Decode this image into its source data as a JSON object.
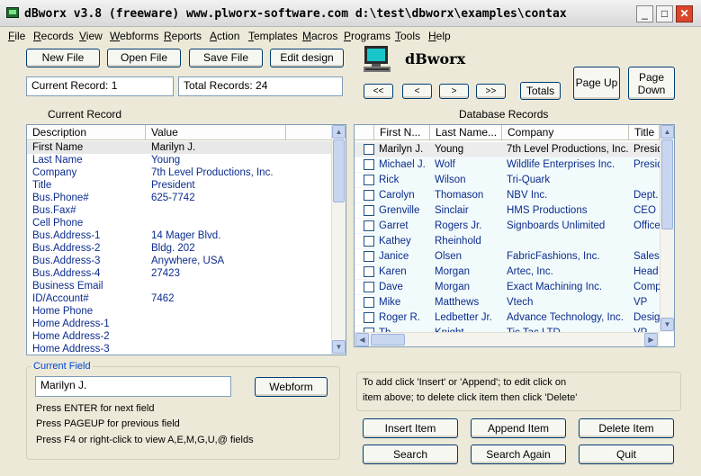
{
  "window": {
    "title": "dBworx  v3.8 (freeware)  www.plworx-software.com   d:\\test\\dbworx\\examples\\contax",
    "minimize": "_",
    "maximize": "□",
    "close": "✕"
  },
  "menu": [
    "File",
    "Records",
    "View",
    "Webforms",
    "Reports",
    "Action",
    "Templates",
    "Macros",
    "Programs",
    "Tools",
    "Help"
  ],
  "toolbar": {
    "new_file": "New File",
    "open_file": "Open File",
    "save_file": "Save File",
    "edit_design": "Edit design"
  },
  "brand": "dBworx",
  "status": {
    "current_record": "Current Record: 1",
    "total_records": "Total Records: 24"
  },
  "nav": {
    "first": "<<",
    "prev": "<",
    "next": ">",
    "last": ">>",
    "totals": "Totals",
    "page_up": "Page Up",
    "page_down": "Page Down"
  },
  "left_panel": {
    "heading": "Current Record",
    "columns": [
      "Description",
      "Value"
    ],
    "rows": [
      {
        "d": "First Name",
        "v": "Marilyn J."
      },
      {
        "d": "Last Name",
        "v": "Young"
      },
      {
        "d": "Company",
        "v": "7th Level Productions, Inc."
      },
      {
        "d": "Title",
        "v": "President"
      },
      {
        "d": "Bus.Phone#",
        "v": "625-7742"
      },
      {
        "d": "Bus.Fax#",
        "v": ""
      },
      {
        "d": "Cell Phone",
        "v": ""
      },
      {
        "d": "Bus.Address-1",
        "v": "14 Mager Blvd."
      },
      {
        "d": "Bus.Address-2",
        "v": "Bldg. 202"
      },
      {
        "d": "Bus.Address-3",
        "v": "Anywhere, USA"
      },
      {
        "d": "Bus.Address-4",
        "v": "27423"
      },
      {
        "d": "Business Email",
        "v": ""
      },
      {
        "d": "ID/Account#",
        "v": "7462"
      },
      {
        "d": "Home Phone",
        "v": ""
      },
      {
        "d": "Home Address-1",
        "v": ""
      },
      {
        "d": "Home Address-2",
        "v": ""
      },
      {
        "d": "Home Address-3",
        "v": ""
      }
    ]
  },
  "right_panel": {
    "heading": "Database Records",
    "columns": [
      "First N...",
      "Last Name...",
      "Company",
      "Title"
    ],
    "rows": [
      {
        "f": "Marilyn J.",
        "l": "Young",
        "c": "7th Level Productions, Inc.",
        "t": "Presid"
      },
      {
        "f": "Michael J.",
        "l": "Wolf",
        "c": "Wildlife Enterprises Inc.",
        "t": "Presid"
      },
      {
        "f": "Rick",
        "l": "Wilson",
        "c": "Tri-Quark",
        "t": ""
      },
      {
        "f": "Carolyn",
        "l": "Thomason",
        "c": "NBV Inc.",
        "t": "Dept."
      },
      {
        "f": "Grenville",
        "l": "Sinclair",
        "c": "HMS Productions",
        "t": "CEO"
      },
      {
        "f": "Garret",
        "l": "Rogers Jr.",
        "c": "Signboards Unlimited",
        "t": "Office"
      },
      {
        "f": "Kathey",
        "l": "Rheinhold",
        "c": "",
        "t": ""
      },
      {
        "f": "Janice",
        "l": "Olsen",
        "c": "FabricFashions, Inc.",
        "t": "Sales"
      },
      {
        "f": "Karen",
        "l": "Morgan",
        "c": "Artec, Inc.",
        "t": "Head"
      },
      {
        "f": "Dave",
        "l": "Morgan",
        "c": "Exact Machining Inc.",
        "t": "Compt"
      },
      {
        "f": "Mike",
        "l": "Matthews",
        "c": "Vtech",
        "t": "VP"
      },
      {
        "f": "Roger R.",
        "l": "Ledbetter Jr.",
        "c": "Advance Technology, Inc.",
        "t": "Design"
      },
      {
        "f": "Th...",
        "l": "Knight",
        "c": "Tic Tac LTD",
        "t": "VP"
      }
    ]
  },
  "current_field": {
    "label": "Current Field",
    "value": "Marilyn J.",
    "webform": "Webform",
    "help": [
      "Press ENTER for next field",
      "Press PAGEUP for previous field",
      "Press F4 or right-click to view A,E,M,G,U,@ fields"
    ]
  },
  "info": [
    "To add click 'Insert' or 'Append'; to edit click on",
    "item above; to delete click item then click 'Delete'"
  ],
  "actions": {
    "insert": "Insert Item",
    "append": "Append Item",
    "delete": "Delete Item",
    "search": "Search",
    "search_again": "Search Again",
    "quit": "Quit"
  }
}
